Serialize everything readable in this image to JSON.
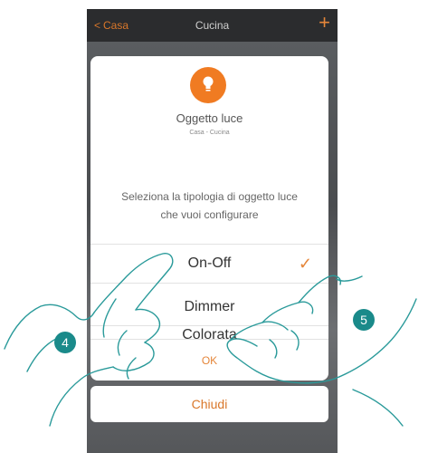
{
  "navbar": {
    "back_label": "Casa",
    "title": "Cucina",
    "add_icon": "plus-icon"
  },
  "dialog": {
    "icon": "light-bulb-icon",
    "title": "Oggetto luce",
    "subtitle": "Casa - Cucina",
    "description": "Seleziona la tipologia di oggetto luce che vuoi configurare",
    "options": [
      {
        "label": "On-Off",
        "selected": true
      },
      {
        "label": "Dimmer",
        "selected": false
      },
      {
        "label": "Colorata",
        "selected": false
      }
    ],
    "ok_label": "OK"
  },
  "close_label": "Chiudi",
  "annotations": {
    "step_left": "4",
    "step_right": "5"
  },
  "colors": {
    "accent": "#e5863a",
    "badge": "#1a8a8a",
    "hand_outline": "#2a9a9a"
  }
}
